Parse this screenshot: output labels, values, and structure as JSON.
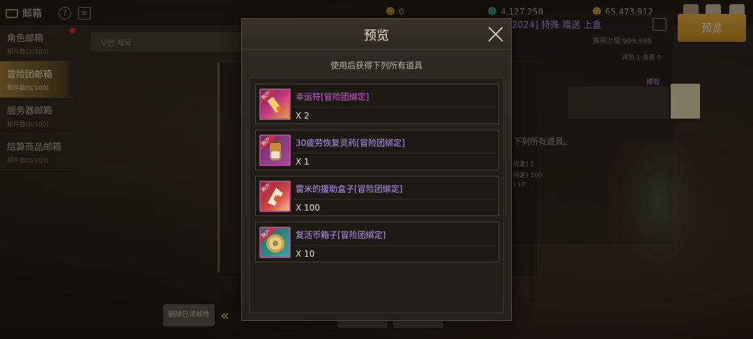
{
  "top_bar": {
    "title": "邮箱",
    "currencies": [
      "0",
      "4,127,258",
      "65,473,912"
    ]
  },
  "sidebar": {
    "items": [
      {
        "label": "角色邮箱",
        "count": "邮件数(2/100)"
      },
      {
        "label": "冒险团邮箱",
        "count": "邮件数(0/100)"
      },
      {
        "label": "服务器邮箱",
        "count": "邮件数(0/100)"
      },
      {
        "label": "结算商品邮箱",
        "count": "邮件数(0/100)"
      }
    ]
  },
  "search": {
    "placeholder": "우편 제목"
  },
  "bottom": {
    "delete_read": "删除已读邮件"
  },
  "right_panel": {
    "title": "2024] 特殊 赠送 上盒",
    "carry_limit": "携带上限 999,999",
    "bag_line": "背包 1 金库 0",
    "rarity": "稀有",
    "desc": "下列所有道具。",
    "small_lines": [
      "绑定) 1",
      "绑定) 100",
      ") 10"
    ]
  },
  "preview_button": "预览",
  "modal": {
    "title": "预览",
    "subtitle": "使用后获得下列所有道具",
    "items": [
      {
        "name": "幸运符[冒险团绑定]",
        "qty": "X 2",
        "icon": "lucky-charm-icon",
        "badge": "账户",
        "name_color": "#dc4de6"
      },
      {
        "name": "30疲劳恢复灵药[冒险团绑定]",
        "qty": "X 1",
        "icon": "fatigue-potion-icon",
        "badge": "账户",
        "name_color": "#b890f5"
      },
      {
        "name": "雷米的援助盒子[冒险团绑定]",
        "qty": "X 100",
        "icon": "support-box-icon",
        "badge": "账户",
        "name_color": "#b890f5"
      },
      {
        "name": "复活币箱子[冒险团绑定]",
        "qty": "X 10",
        "icon": "revival-coin-box-icon",
        "badge": "账户",
        "name_color": "#b890f5"
      }
    ]
  },
  "colors": {
    "accent": "#e8b23e",
    "rare_name": "#dc4de6",
    "item_name": "#b890f5"
  }
}
